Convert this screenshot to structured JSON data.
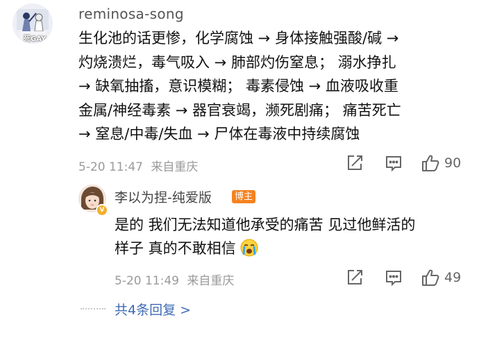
{
  "comment": {
    "username": "reminosa-song",
    "avatar_text": "死GAY",
    "lines": [
      "生化池的话更惨，化学腐蚀 → 身体接触强酸/碱 →",
      "灼烧溃烂，毒气吸入 → 肺部灼伤窒息；   溺水挣扎",
      "→ 缺氧抽搐，意识模糊；   毒素侵蚀 → 血液吸收重",
      "金属/神经毒素 → 器官衰竭，濒死剧痛；   痛苦死亡",
      "→ 窒息/中毒/失血 → 尸体在毒液中持续腐蚀"
    ],
    "time": "5-20 11:47",
    "source": "来自重庆",
    "likes": "90"
  },
  "reply": {
    "username": "李以为捏-纯爱版",
    "op_badge": "博主",
    "lines": [
      "是的 我们无法知道他承受的痛苦 见过他鲜活的",
      "样子 真的不敢相信"
    ],
    "emoji": "crying-face-icon",
    "time": "5-20 11:49",
    "source": "来自重庆",
    "likes": "49"
  },
  "more_replies": "共4条回复 >",
  "colors": {
    "meta_gray": "#9a9a9a",
    "link_blue": "#3f6bb3",
    "op_badge_orange": "#f58220",
    "vip_badge_gold": "#f3b02b"
  }
}
